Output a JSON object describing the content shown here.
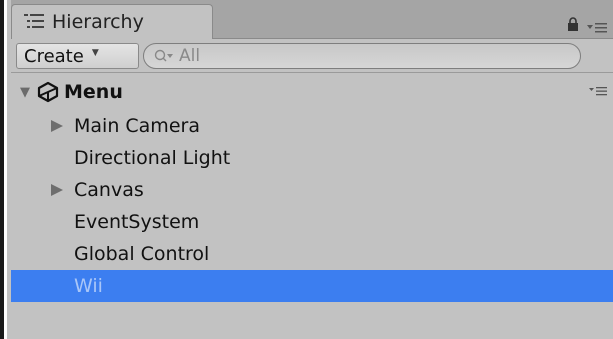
{
  "tab": {
    "title": "Hierarchy"
  },
  "toolbar": {
    "create_label": "Create",
    "search_placeholder": "All"
  },
  "scene": {
    "name": "Menu"
  },
  "items": [
    {
      "label": "Main Camera",
      "has_children": true,
      "selected": false
    },
    {
      "label": "Directional Light",
      "has_children": false,
      "selected": false
    },
    {
      "label": "Canvas",
      "has_children": true,
      "selected": false
    },
    {
      "label": "EventSystem",
      "has_children": false,
      "selected": false
    },
    {
      "label": "Global Control",
      "has_children": false,
      "selected": false
    },
    {
      "label": "Wii",
      "has_children": false,
      "selected": true
    }
  ],
  "colors": {
    "panel": "#c2c2c2",
    "tabstrip": "#a5a5a5",
    "selection": "#3c7ef0",
    "selected_text": "#a9c6f8"
  }
}
